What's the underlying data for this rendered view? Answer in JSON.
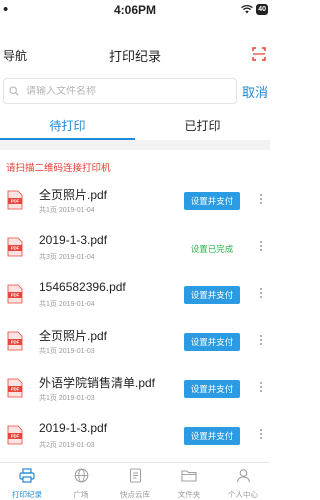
{
  "status_bar": {
    "time": "4:06PM",
    "battery": "40"
  },
  "nav": {
    "left_label": "导航",
    "title": "打印纪录"
  },
  "search": {
    "placeholder": "请输入文件名称",
    "value": "",
    "cancel_label": "取消"
  },
  "tabs": [
    {
      "label": "待打印",
      "active": true
    },
    {
      "label": "已打印",
      "active": false
    }
  ],
  "notice": "请扫描二维码连接打印机",
  "records": [
    {
      "name": "全页照片.pdf",
      "meta": "共1页 2019-01-04",
      "action": "设置并支付",
      "done": false
    },
    {
      "name": "2019-1-3.pdf",
      "meta": "共3页 2019-01-04",
      "action": "设置已完成",
      "done": true
    },
    {
      "name": "1546582396.pdf",
      "meta": "共1页 2019-01-04",
      "action": "设置并支付",
      "done": false
    },
    {
      "name": "全页照片.pdf",
      "meta": "共1页 2019-01-03",
      "action": "设置并支付",
      "done": false
    },
    {
      "name": "外语学院销售清单.pdf",
      "meta": "共1页 2019-01-03",
      "action": "设置并支付",
      "done": false
    },
    {
      "name": "2019-1-3.pdf",
      "meta": "共2页 2019-01-03",
      "action": "设置并支付",
      "done": false
    }
  ],
  "tabbar": [
    {
      "label": "打印纪录",
      "icon": "printer-icon",
      "active": true
    },
    {
      "label": "广场",
      "icon": "globe-icon",
      "active": false
    },
    {
      "label": "快点云库",
      "icon": "document-icon",
      "active": false
    },
    {
      "label": "文件夹",
      "icon": "folder-icon",
      "active": false
    },
    {
      "label": "个人中心",
      "icon": "user-icon",
      "active": false
    }
  ],
  "colors": {
    "accent": "#1f8ad7",
    "button": "#2b9be3",
    "notice": "#e8382f",
    "done": "#2bb34a",
    "pdf": "#e8453c"
  }
}
